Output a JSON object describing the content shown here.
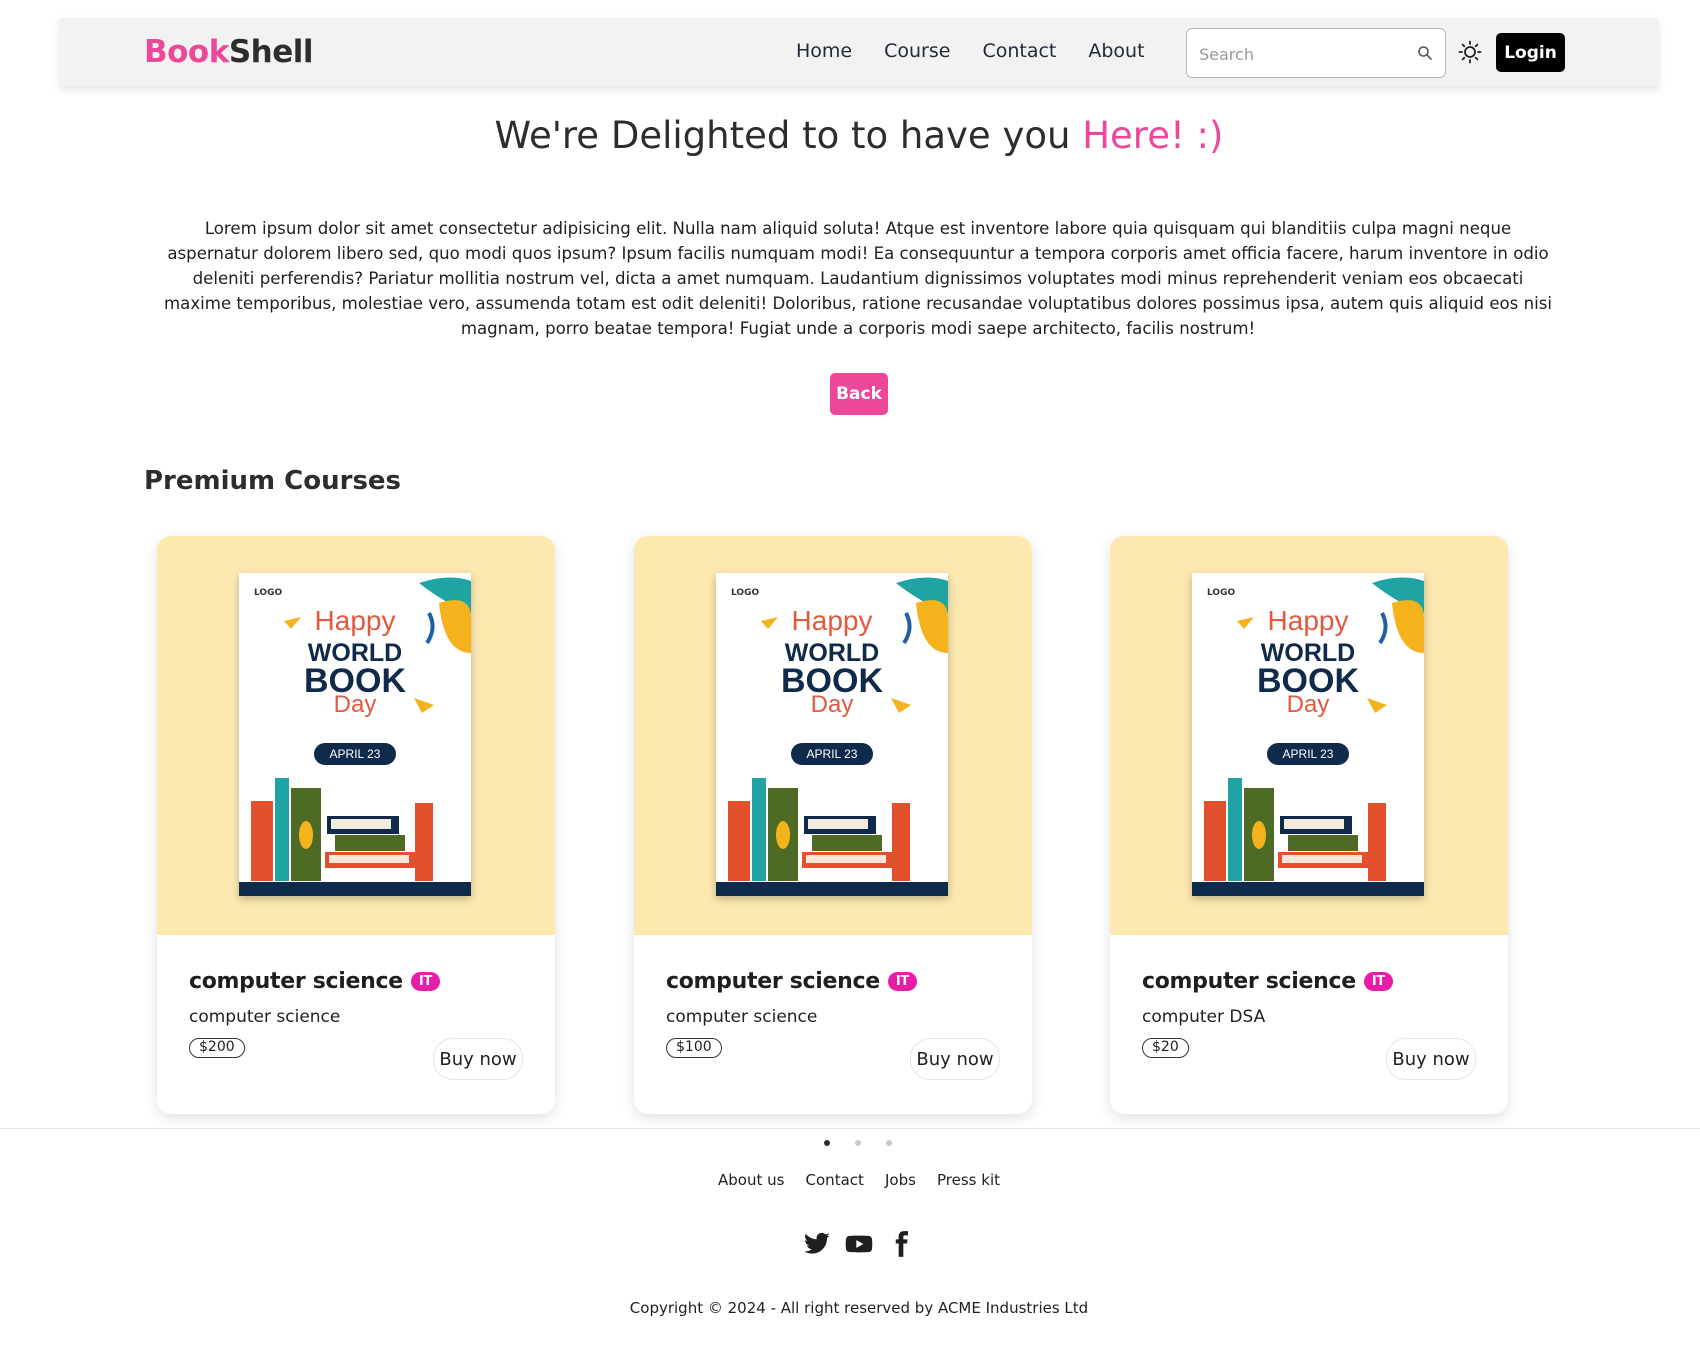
{
  "brand": {
    "part1": "Book",
    "part2": "Shell"
  },
  "nav": {
    "links": [
      "Home",
      "Course",
      "Contact",
      "About"
    ],
    "search_placeholder": "Search",
    "login_label": "Login"
  },
  "hero": {
    "title_main": "We're Delighted to to have you ",
    "title_accent": "Here! :)",
    "text": "Lorem ipsum dolor sit amet consectetur adipisicing elit. Nulla nam aliquid soluta! Atque est inventore labore quia quisquam qui blanditiis culpa magni neque aspernatur dolorem libero sed, quo modi quos ipsum? Ipsum facilis numquam modi! Ea consequuntur a tempora corporis amet officia facere, harum inventore in odio deleniti perferendis? Pariatur mollitia nostrum vel, dicta a amet numquam. Laudantium dignissimos voluptates modi minus reprehenderit veniam eos obcaecati maxime temporibus, molestiae vero, assumenda totam est odit deleniti! Doloribus, ratione recusandae voluptatibus dolores possimus ipsa, autem quis aliquid eos nisi magnam, porro beatae tempora! Fugiat unde a corporis modi saepe architecto, facilis nostrum!",
    "back_label": "Back"
  },
  "section_title": "Premium Courses",
  "poster": {
    "logo": "LOGO",
    "happy": "Happy",
    "world": "WORLD",
    "book": "BOOK",
    "day": "Day",
    "date": "APRIL 23"
  },
  "courses": [
    {
      "title": "computer science",
      "badge": "IT",
      "subtitle": "computer science",
      "price": "$200",
      "buy_label": "Buy now"
    },
    {
      "title": "computer science",
      "badge": "IT",
      "subtitle": "computer science",
      "price": "$100",
      "buy_label": "Buy now"
    },
    {
      "title": "computer science",
      "badge": "IT",
      "subtitle": "computer DSA",
      "price": "$20",
      "buy_label": "Buy now"
    }
  ],
  "carousel": {
    "pages": 3,
    "active": 1
  },
  "footer": {
    "links": [
      "About us",
      "Contact",
      "Jobs",
      "Press kit"
    ],
    "social_icons": [
      "twitter-icon",
      "youtube-icon",
      "facebook-icon"
    ],
    "copyright": "Copyright © 2024 - All right reserved by ACME Industries Ltd"
  },
  "colors": {
    "accent": "#ec4899",
    "badge": "#e81ca8",
    "card_media": "#fde9b0",
    "navbar": "#f2f2f2"
  }
}
